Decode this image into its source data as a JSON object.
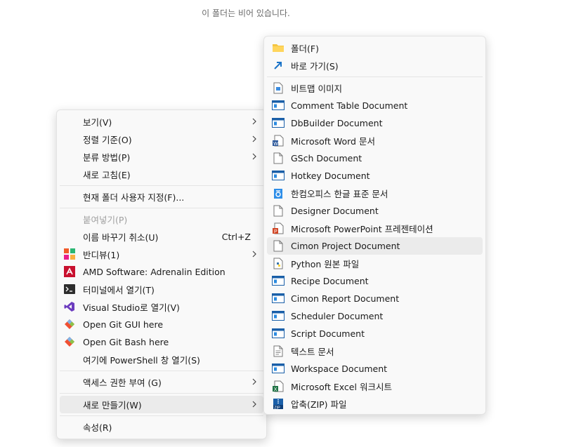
{
  "empty_folder_text": "이 폴더는 비어 있습니다.",
  "context_menu": {
    "view": "보기(V)",
    "sort": "정렬 기준(O)",
    "group": "분류 방법(P)",
    "refresh": "새로 고침(E)",
    "customize": "현재 폴더 사용자 지정(F)...",
    "paste": "붙여넣기(P)",
    "undo_rename": "이름 바꾸기 취소(U)",
    "undo_shortcut": "Ctrl+Z",
    "bandiview": "반디뷰(1)",
    "amd": "AMD Software: Adrenalin Edition",
    "terminal": "터미널에서 열기(T)",
    "vs": "Visual Studio로 열기(V)",
    "git_gui": "Open Git GUI here",
    "git_bash": "Open Git Bash here",
    "powershell": "여기에 PowerShell 창 열기(S)",
    "access": "액세스 권한 부여 (G)",
    "new": "새로 만들기(W)",
    "properties": "속성(R)"
  },
  "new_submenu": {
    "folder": "폴더(F)",
    "shortcut": "바로 가기(S)",
    "bitmap": "비트맵 이미지",
    "comment_table": "Comment Table Document",
    "dbbuilder": "DbBuilder Document",
    "word": "Microsoft Word 문서",
    "gsch": "GSch Document",
    "hotkey": "Hotkey Document",
    "hwp": "한컴오피스 한글 표준 문서",
    "designer": "Designer Document",
    "powerpoint": "Microsoft PowerPoint 프레젠테이션",
    "cimon_project": "Cimon Project Document",
    "python": "Python 원본 파일",
    "recipe": "Recipe Document",
    "cimon_report": "Cimon Report Document",
    "scheduler": "Scheduler Document",
    "script": "Script Document",
    "text": "텍스트 문서",
    "workspace": "Workspace Document",
    "excel": "Microsoft Excel 워크시트",
    "zip": "압축(ZIP) 파일"
  },
  "colors": {
    "folder": "#f4c542",
    "accent_blue": "#1a73c8",
    "word": "#2b579a",
    "ppt": "#d24726",
    "excel": "#217346",
    "amd": "#c8102e",
    "vs": "#6c3cbf"
  }
}
